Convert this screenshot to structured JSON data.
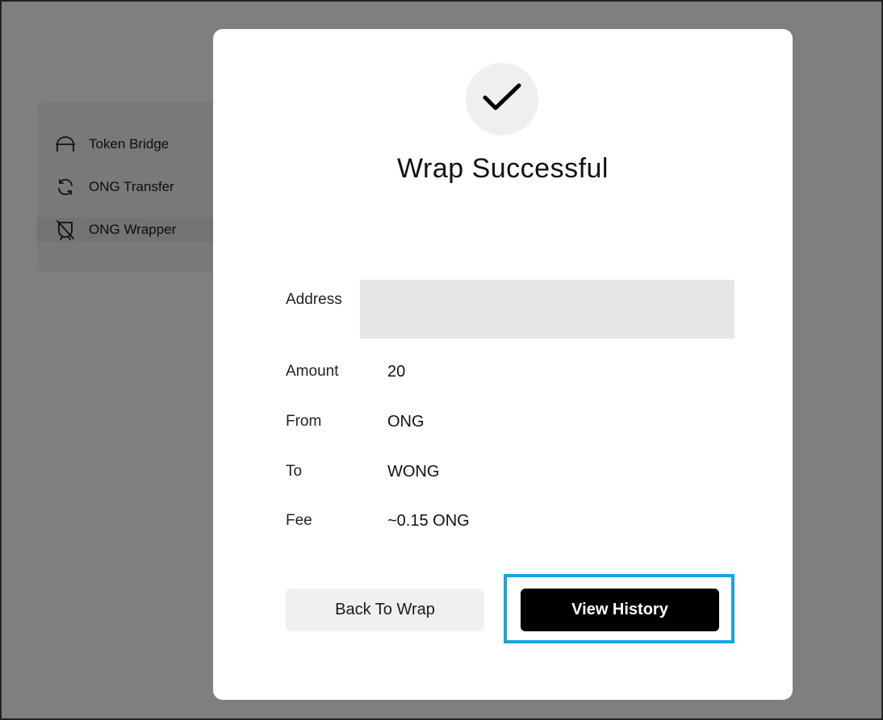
{
  "sidebar": {
    "items": [
      {
        "label": "Token Bridge",
        "icon": "bridge-icon"
      },
      {
        "label": "ONG Transfer",
        "icon": "refresh-icon"
      },
      {
        "label": "ONG Wrapper",
        "icon": "wrapper-icon"
      }
    ]
  },
  "modal": {
    "status_icon": "check-icon",
    "title": "Wrap Successful",
    "fields": {
      "address_label": "Address",
      "address_value": "",
      "amount_label": "Amount",
      "amount_value": "20",
      "from_label": "From",
      "from_value": "ONG",
      "to_label": "To",
      "to_value": "WONG",
      "fee_label": "Fee",
      "fee_value": "~0.15 ONG"
    },
    "buttons": {
      "back_label": "Back To Wrap",
      "history_label": "View History"
    }
  },
  "colors": {
    "overlay": "rgba(0,0,0,0.5)",
    "primary_button": "#000000",
    "highlight": "#1aa3dd"
  }
}
